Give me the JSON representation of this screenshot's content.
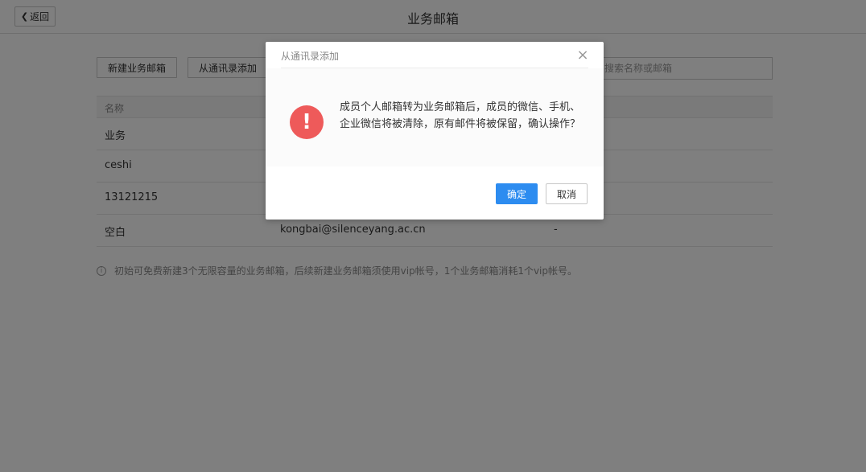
{
  "header": {
    "back_icon": "chevron-left-icon",
    "back_icon_glyph": "❮",
    "back_label": "返回",
    "title": "业务邮箱"
  },
  "toolbar": {
    "new_label": "新建业务邮箱",
    "contacts_label": "从通讯录添加",
    "search_placeholder": "搜索名称或邮箱"
  },
  "table": {
    "header": {
      "name": "名称"
    },
    "rows": [
      {
        "name": "业务",
        "email": "",
        "extra": ""
      },
      {
        "name": "ceshi",
        "email": "",
        "extra": ""
      },
      {
        "name": "13121215",
        "email": "",
        "extra": ""
      },
      {
        "name": "空白",
        "email": "kongbai@silenceyang.ac.cn",
        "extra": "-"
      }
    ]
  },
  "tip": {
    "icon": "info-icon",
    "icon_glyph": "i",
    "text": "初始可免费新建3个无限容量的业务邮箱，后续新建业务邮箱须使用vip帐号，1个业务邮箱消耗1个vip帐号。"
  },
  "modal": {
    "title": "从通讯录添加",
    "close_glyph": "×",
    "warning_glyph": "!",
    "message": "成员个人邮箱转为业务邮箱后，成员的微信、手机、企业微信将被清除，原有邮件将被保留，确认操作？",
    "ok_label": "确定",
    "cancel_label": "取消"
  },
  "colors": {
    "primary": "#2d8cf0",
    "warning": "#ee5a5a",
    "overlay": "rgba(0,0,0,0.5)"
  }
}
